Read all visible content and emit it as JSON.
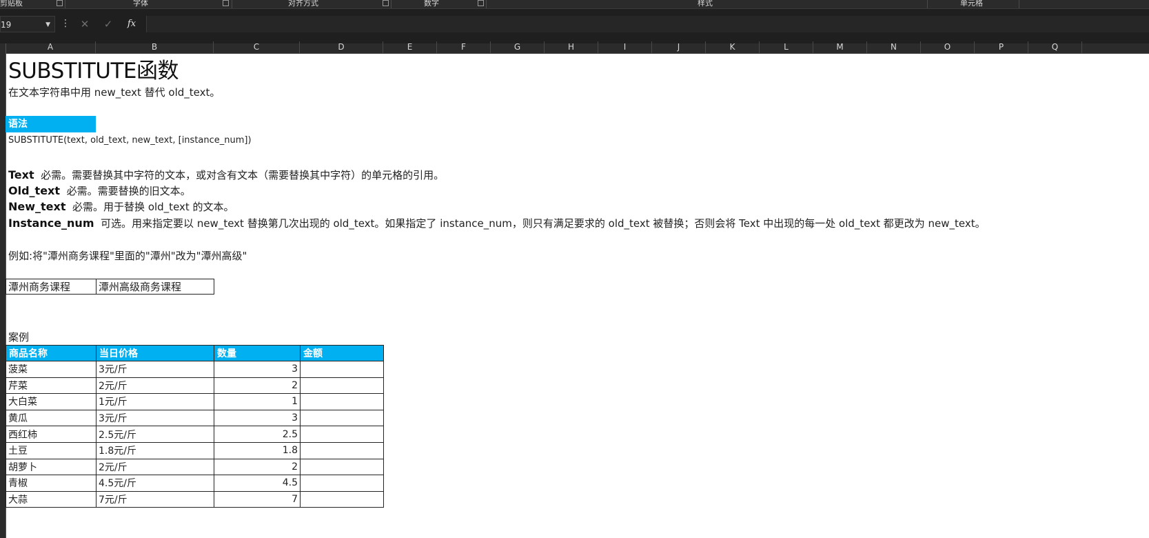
{
  "ribbon": {
    "groups": [
      "剪贴板",
      "字体",
      "对齐方式",
      "数字",
      "样式",
      "单元格"
    ]
  },
  "formula_bar": {
    "name_box": "19",
    "more_icon": "⋮",
    "cancel_icon": "✕",
    "enter_icon": "✓",
    "fx_label": "fx",
    "formula": ""
  },
  "columns": [
    "A",
    "B",
    "C",
    "D",
    "E",
    "F",
    "G",
    "H",
    "I",
    "J",
    "K",
    "L",
    "M",
    "N",
    "O",
    "P",
    "Q"
  ],
  "sheet": {
    "title": "SUBSTITUTE函数",
    "description": "在文本字符串中用 new_text 替代 old_text。",
    "syntax_header": "语法",
    "syntax": "SUBSTITUTE(text, old_text, new_text, [instance_num])",
    "args": [
      {
        "name": "Text",
        "desc": "必需。需要替换其中字符的文本，或对含有文本（需要替换其中字符）的单元格的引用。"
      },
      {
        "name": "Old_text",
        "desc": "必需。需要替换的旧文本。"
      },
      {
        "name": "New_text",
        "desc": "必需。用于替换 old_text 的文本。"
      },
      {
        "name": "Instance_num",
        "desc": "可选。用来指定要以 new_text 替换第几次出现的 old_text。如果指定了 instance_num，则只有满足要求的 old_text 被替换；否则会将 Text 中出现的每一处 old_text 都更改为 new_text。"
      }
    ],
    "example_text": "例如:将\"潭州商务课程\"里面的\"潭州\"改为\"潭州高级\"",
    "example_before": "潭州商务课程",
    "example_after": "潭州高级商务课程",
    "case_label": "案例",
    "table_headers": [
      "商品名称",
      "当日价格",
      "数量",
      "金额"
    ],
    "table_rows": [
      [
        "菠菜",
        "3元/斤",
        "3",
        ""
      ],
      [
        "芹菜",
        "2元/斤",
        "2",
        ""
      ],
      [
        "大白菜",
        "1元/斤",
        "1",
        ""
      ],
      [
        "黄瓜",
        "3元/斤",
        "3",
        ""
      ],
      [
        "西红柿",
        "2.5元/斤",
        "2.5",
        ""
      ],
      [
        "土豆",
        "1.8元/斤",
        "1.8",
        ""
      ],
      [
        "胡萝卜",
        "2元/斤",
        "2",
        ""
      ],
      [
        "青椒",
        "4.5元/斤",
        "4.5",
        ""
      ],
      [
        "大蒜",
        "7元/斤",
        "7",
        ""
      ]
    ]
  },
  "colors": {
    "header_fill": "#00b0f0",
    "chrome_dark": "#1f1f1f"
  }
}
